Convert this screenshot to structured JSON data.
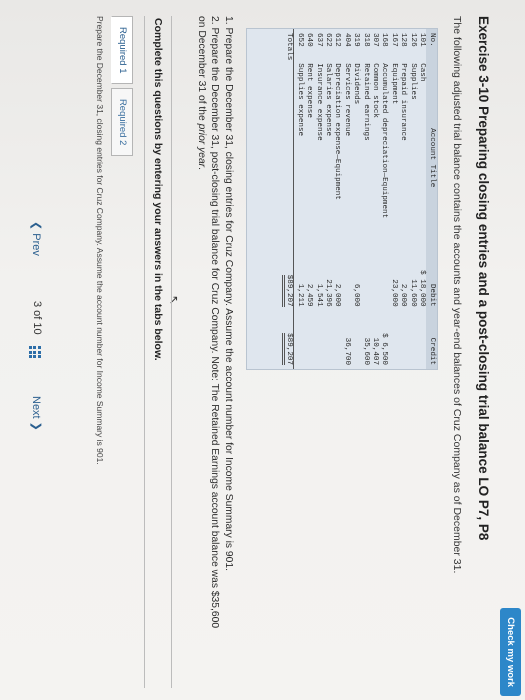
{
  "header": {
    "check_label": "Check my work"
  },
  "exercise": {
    "title": "Exercise 3-10 Preparing closing entries and a post-closing trial balance LO P7, P8",
    "intro": "The following adjusted trial balance contains the accounts and year-end balances of Cruz Company as of December 31."
  },
  "trial_balance": {
    "headers": {
      "no": "No.",
      "title": "Account Title",
      "debit": "Debit",
      "credit": "Credit"
    },
    "rows": [
      {
        "no": "101",
        "title": "Cash",
        "debit": "$ 18,000",
        "credit": ""
      },
      {
        "no": "126",
        "title": "Supplies",
        "debit": "11,600",
        "credit": ""
      },
      {
        "no": "128",
        "title": "Prepaid insurance",
        "debit": "2,000",
        "credit": ""
      },
      {
        "no": "167",
        "title": "Equipment",
        "debit": "23,000",
        "credit": ""
      },
      {
        "no": "168",
        "title": "Accumulated depreciation—Equipment",
        "debit": "",
        "credit": "$ 6,500"
      },
      {
        "no": "307",
        "title": "Common stock",
        "debit": "",
        "credit": "10,407"
      },
      {
        "no": "318",
        "title": "Retained earnings",
        "debit": "",
        "credit": "35,600"
      },
      {
        "no": "319",
        "title": "Dividends",
        "debit": "6,000",
        "credit": ""
      },
      {
        "no": "404",
        "title": "Services revenue",
        "debit": "",
        "credit": "36,700"
      },
      {
        "no": "612",
        "title": "Depreciation expense—Equipment",
        "debit": "2,000",
        "credit": ""
      },
      {
        "no": "622",
        "title": "Salaries expense",
        "debit": "21,396",
        "credit": ""
      },
      {
        "no": "637",
        "title": "Insurance expense",
        "debit": "1,541",
        "credit": ""
      },
      {
        "no": "640",
        "title": "Rent expense",
        "debit": "2,459",
        "credit": ""
      },
      {
        "no": "652",
        "title": "Supplies expense",
        "debit": "1,211",
        "credit": ""
      }
    ],
    "totals": {
      "label": "Totals",
      "debit": "$89,207",
      "credit": "$89,207"
    }
  },
  "instructions": {
    "line1": "1. Prepare the December 31, closing entries for Cruz Company. Assume the account number for Income Summary is 901.",
    "line2": "2. Prepare the December 31, post-closing trial balance for Cruz Company. Note: The Retained Earnings account balance was $35,600",
    "line3_pre": "on December 31 of the ",
    "line3_em": "prior year",
    "line3_post": "."
  },
  "complete_bar": "Complete this questions by entering your answers in the tabs below.",
  "tabs": [
    {
      "label": "Required 1"
    },
    {
      "label": "Required 2"
    }
  ],
  "required_text": "Prepare the December 31, closing entries for Cruz Company. Assume the account number for Income Summary is 901.",
  "pager": {
    "prev": "Prev",
    "page": "3 of 10",
    "next": "Next"
  }
}
